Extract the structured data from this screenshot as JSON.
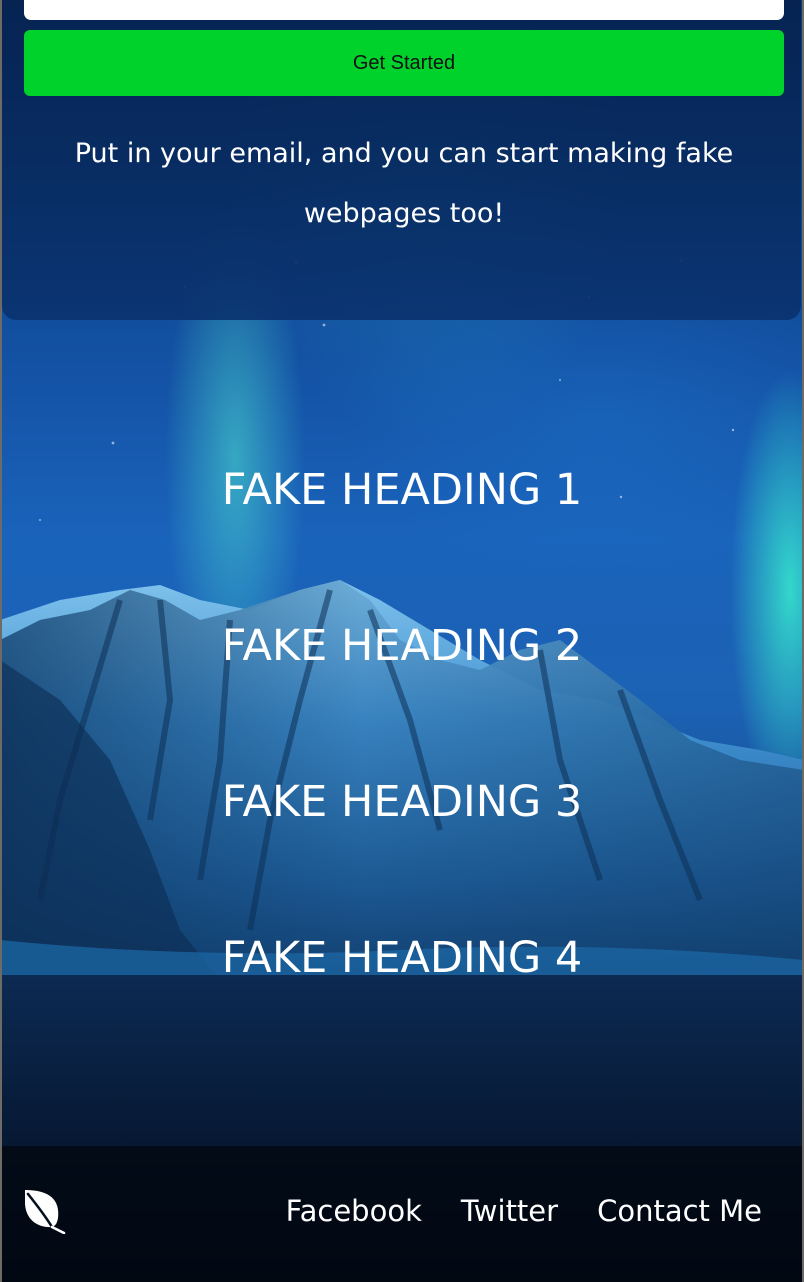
{
  "signup": {
    "email_placeholder": "",
    "cta_label": "Get Started",
    "description": "Put in your email, and you can start making fake webpages too!"
  },
  "features": {
    "headings": [
      "FAKE HEADING 1",
      "FAKE HEADING 2",
      "FAKE HEADING 3",
      "FAKE HEADING 4"
    ]
  },
  "footer": {
    "logo_icon": "leaf-icon",
    "nav": [
      {
        "label": "Facebook"
      },
      {
        "label": "Twitter"
      },
      {
        "label": "Contact Me"
      }
    ]
  },
  "colors": {
    "cta_background": "#00d22c",
    "panel_background": "#082c62",
    "footer_background": "#020812",
    "text": "#ffffff"
  }
}
